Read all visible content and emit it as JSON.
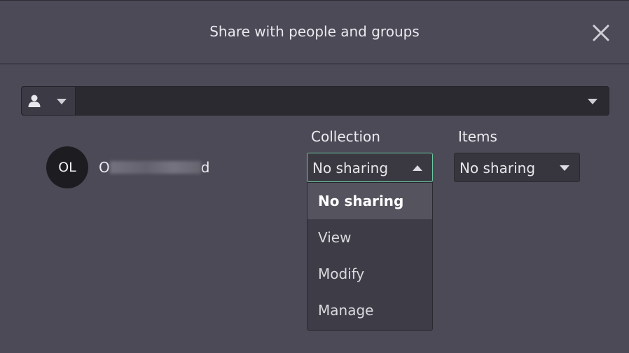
{
  "dialog": {
    "title": "Share with people and groups",
    "close_icon": "close-icon"
  },
  "search": {
    "type_icon": "person-icon",
    "value": "",
    "placeholder": ""
  },
  "columns": {
    "collection": "Collection",
    "items": "Items"
  },
  "user": {
    "initials": "OL",
    "name_first": "O",
    "name_last": "d"
  },
  "collection_select": {
    "value": "No sharing",
    "options": [
      "No sharing",
      "View",
      "Modify",
      "Manage"
    ],
    "selected_index": 0
  },
  "items_select": {
    "value": "No sharing"
  },
  "colors": {
    "background": "#4c4a56",
    "accent_border": "#6cc7a0",
    "avatar_bg": "#1d1c21"
  }
}
